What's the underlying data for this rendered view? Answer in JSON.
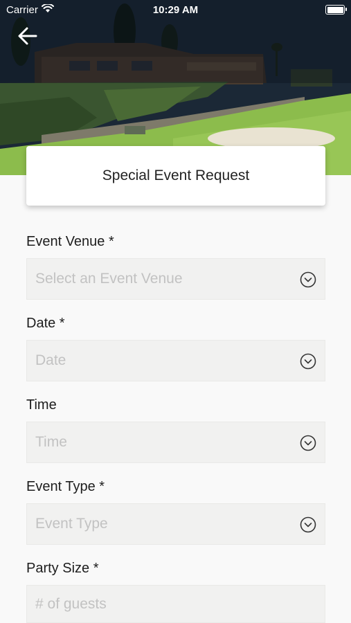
{
  "status_bar": {
    "carrier": "Carrier",
    "time": "10:29 AM"
  },
  "page": {
    "title": "Special Event Request"
  },
  "form": {
    "fields": [
      {
        "label": "Event Venue *",
        "placeholder": "Select an Event Venue",
        "kind": "dropdown"
      },
      {
        "label": "Date *",
        "placeholder": "Date",
        "kind": "dropdown"
      },
      {
        "label": "Time",
        "placeholder": "Time",
        "kind": "dropdown"
      },
      {
        "label": "Event Type *",
        "placeholder": "Event Type",
        "kind": "dropdown"
      },
      {
        "label": "Party Size *",
        "placeholder": "# of guests",
        "kind": "text"
      }
    ]
  },
  "colors": {
    "background": "#f9f9f9",
    "field_bg": "#f1f1f0",
    "placeholder": "#c2c2c2"
  },
  "icons": {
    "back": "back-arrow-icon",
    "chevron": "chevron-down-circle-icon",
    "wifi": "wifi-icon",
    "battery": "battery-icon"
  }
}
